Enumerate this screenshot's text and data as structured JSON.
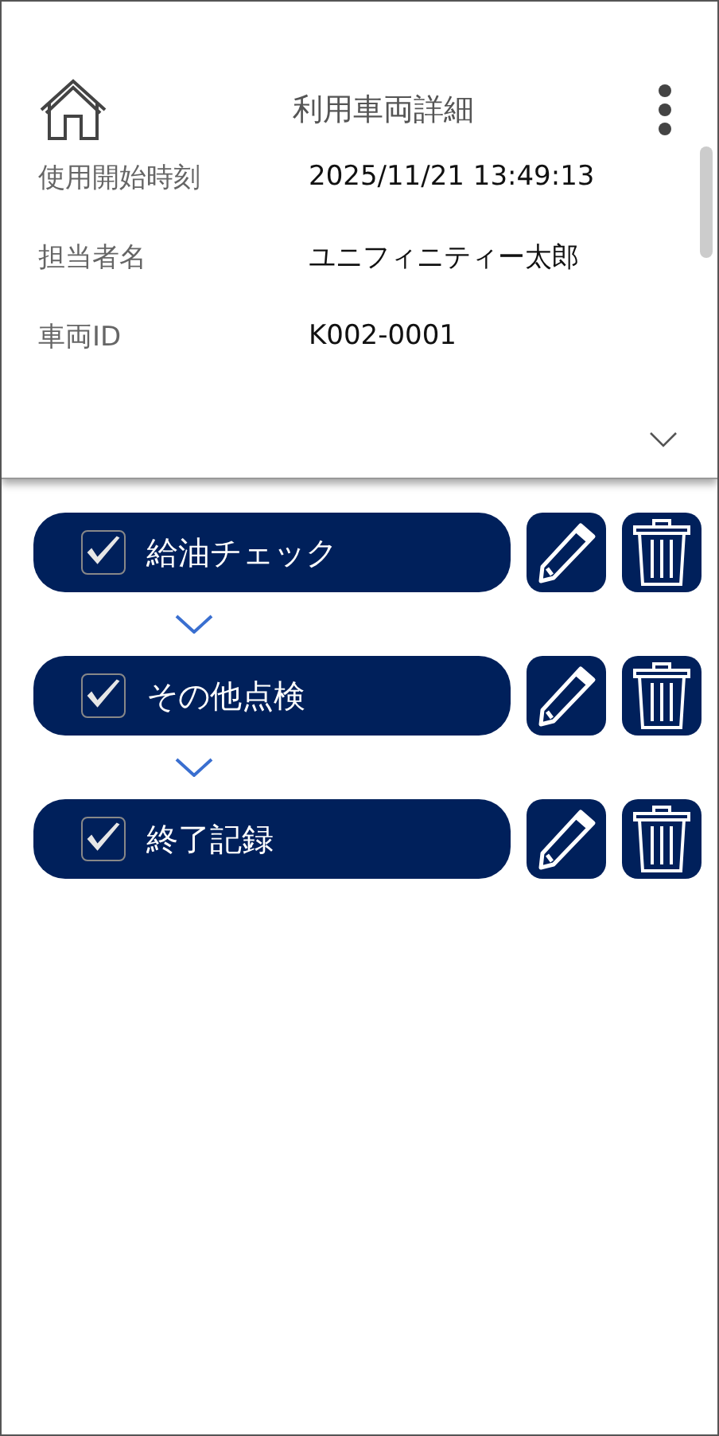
{
  "header": {
    "title": "利用車両詳細"
  },
  "fields": [
    {
      "label": "使用開始時刻",
      "value": "2025/11/21 13:49:13"
    },
    {
      "label": "担当者名",
      "value": "ユニフィニティー太郎"
    },
    {
      "label": "車両ID",
      "value": "K002-0001"
    }
  ],
  "steps": [
    {
      "label": "給油チェック",
      "checked": true
    },
    {
      "label": "その他点検",
      "checked": true
    },
    {
      "label": "終了記録",
      "checked": true
    }
  ]
}
